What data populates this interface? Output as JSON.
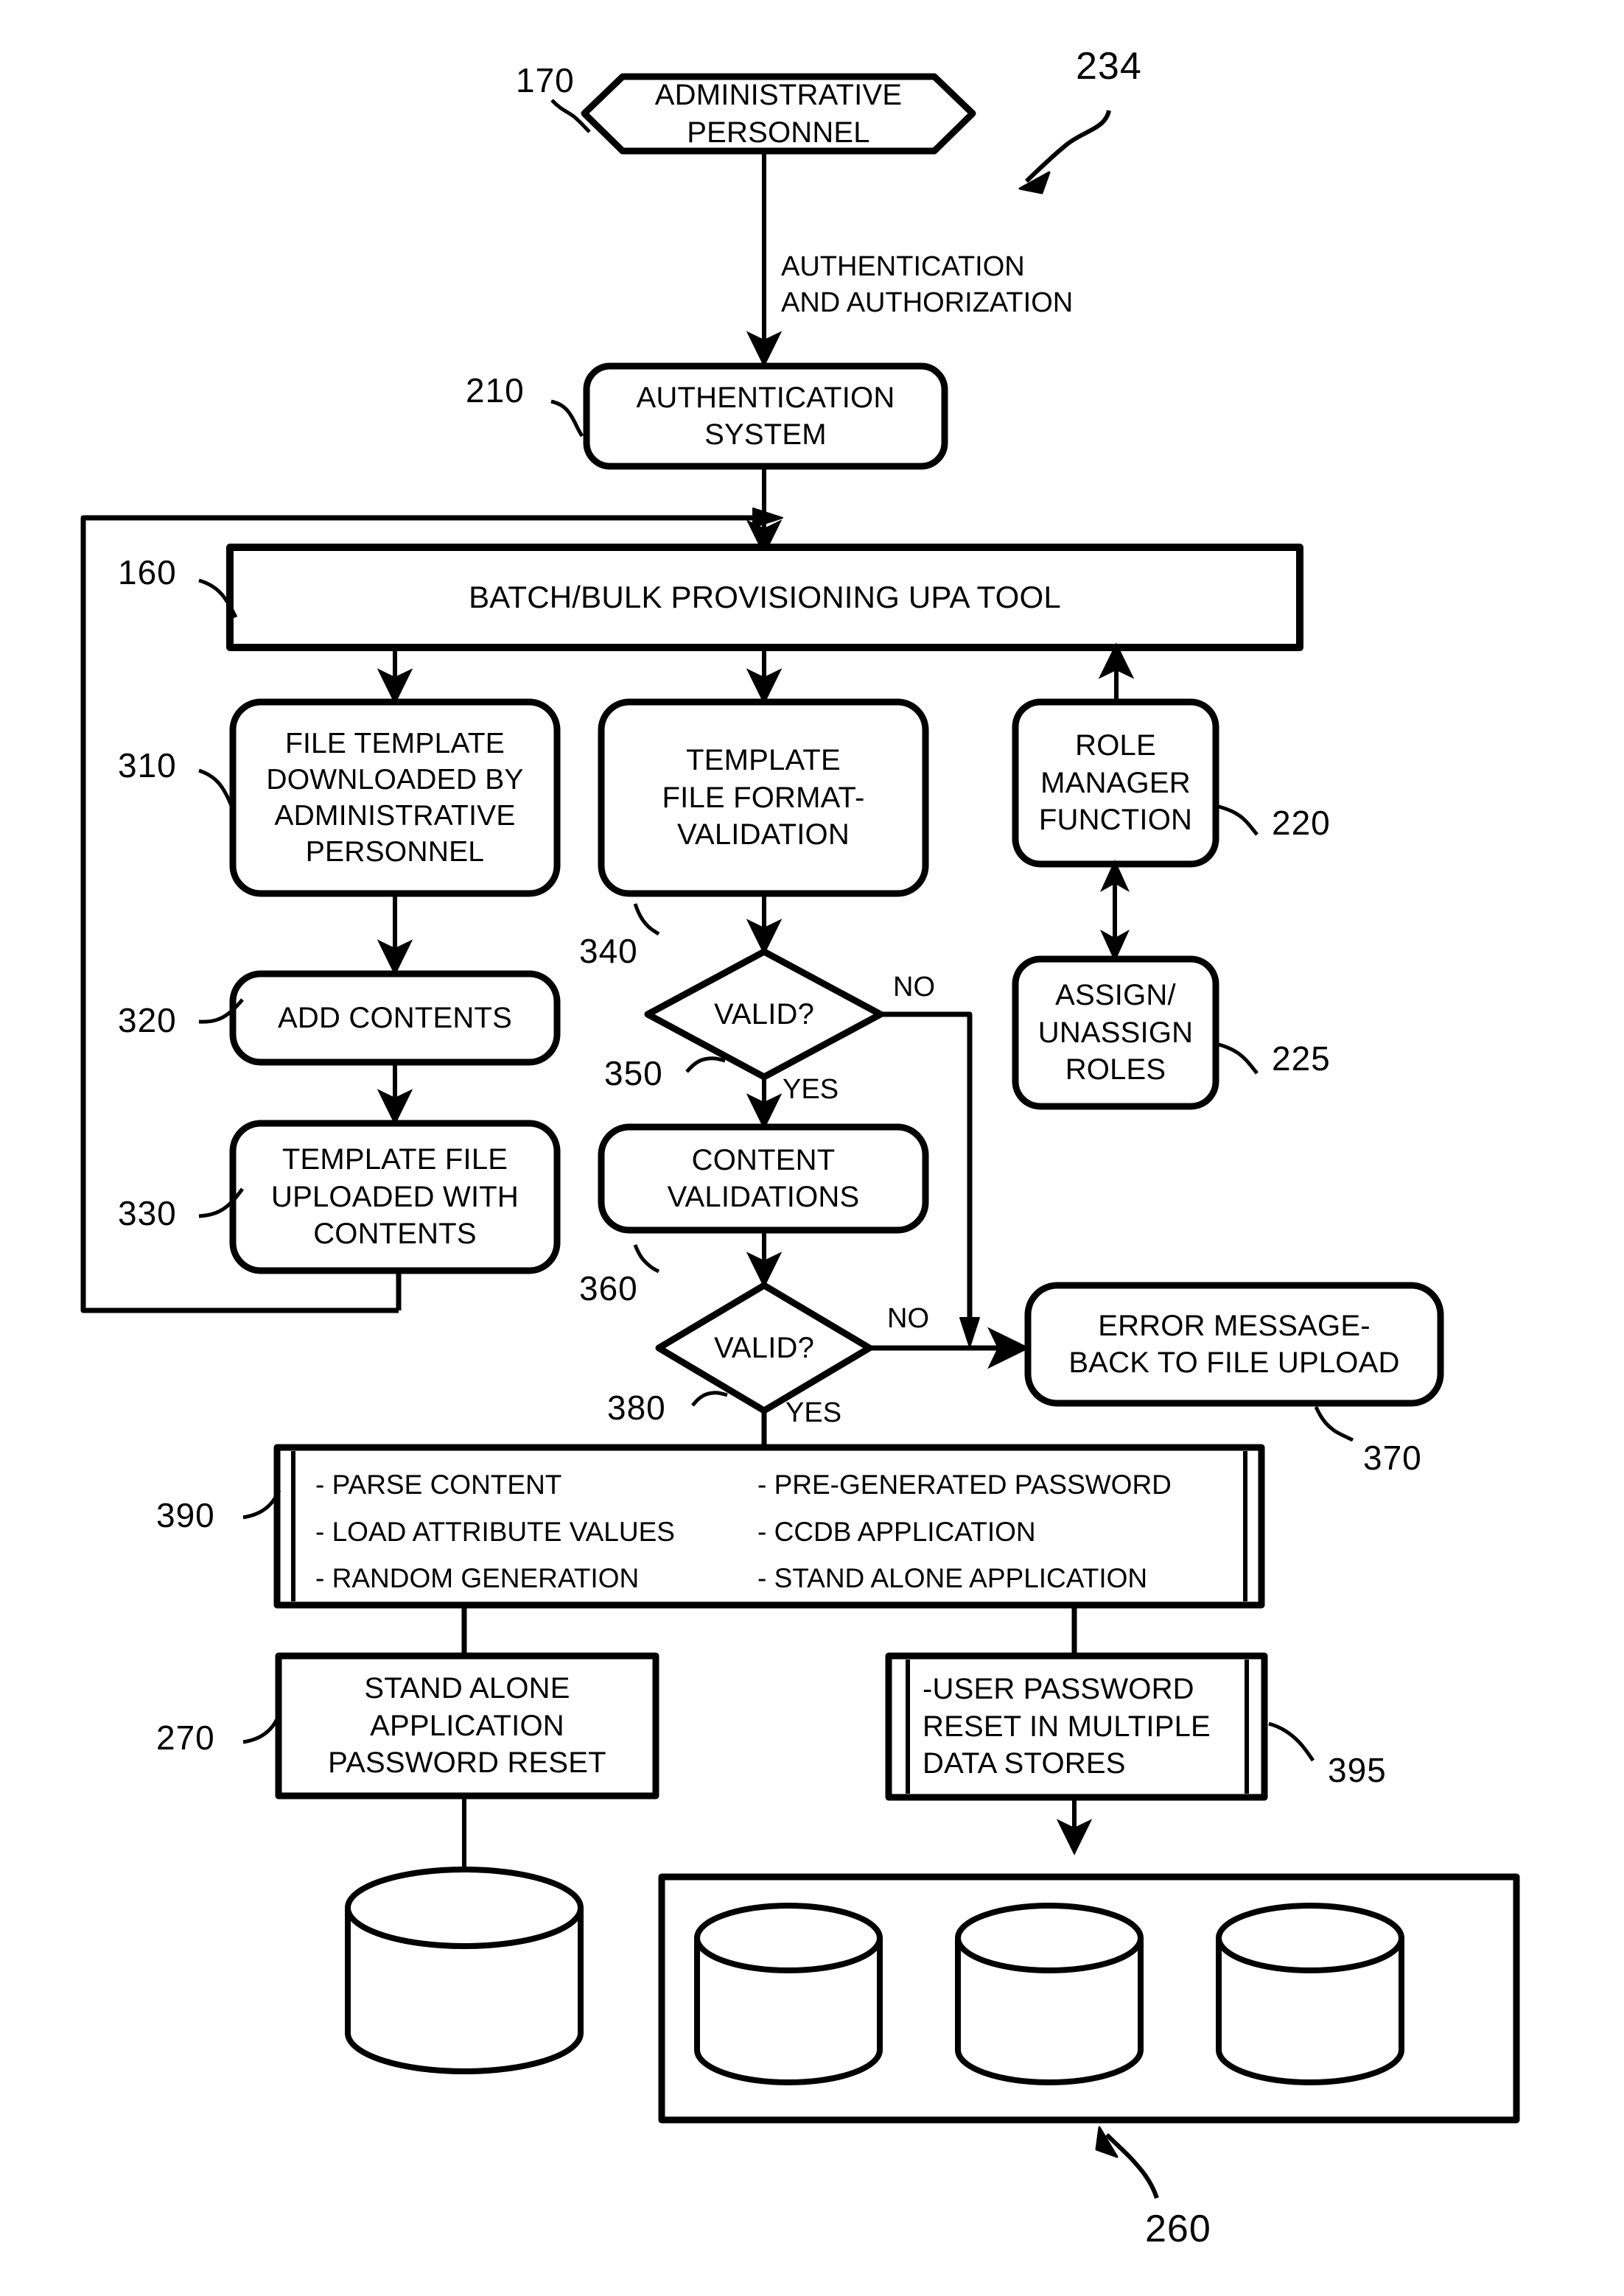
{
  "figure": {
    "ref_label": "234",
    "nodes": {
      "admin_personnel": {
        "ref": "170",
        "text": "ADMINISTRATIVE\nPERSONNEL"
      },
      "auth_system": {
        "ref": "210",
        "text": "AUTHENTICATION\nSYSTEM"
      },
      "upa_tool": {
        "ref": "160",
        "text": "BATCH/BULK PROVISIONING UPA TOOL"
      },
      "file_template": {
        "ref": "310",
        "text": "FILE TEMPLATE\nDOWNLOADED BY\nADMINISTRATIVE\nPERSONNEL"
      },
      "add_contents": {
        "ref": "320",
        "text": "ADD CONTENTS"
      },
      "template_uploaded": {
        "ref": "330",
        "text": "TEMPLATE FILE\nUPLOADED WITH\nCONTENTS"
      },
      "format_validation": {
        "ref": "340",
        "text": "TEMPLATE\nFILE FORMAT-\nVALIDATION"
      },
      "valid_decision_1": {
        "ref": "350",
        "text": "VALID?"
      },
      "content_validations": {
        "ref": "360",
        "text": "CONTENT\nVALIDATIONS"
      },
      "valid_decision_2": {
        "ref": "380",
        "text": "VALID?"
      },
      "role_manager": {
        "ref": "220",
        "text": "ROLE\nMANAGER\nFUNCTION"
      },
      "assign_roles": {
        "ref": "225",
        "text": "ASSIGN/\nUNASSIGN\nROLES"
      },
      "error_message": {
        "ref": "370",
        "text": "ERROR MESSAGE-\nBACK TO FILE UPLOAD"
      },
      "processing": {
        "ref": "390",
        "left_items": "- PARSE CONTENT\n- LOAD ATTRIBUTE VALUES\n- RANDOM GENERATION",
        "right_items": "- PRE-GENERATED PASSWORD\n- CCDB APPLICATION\n- STAND ALONE APPLICATION"
      },
      "standalone_reset": {
        "ref": "270",
        "text": "STAND ALONE\nAPPLICATION\nPASSWORD RESET"
      },
      "multi_reset": {
        "ref": "395",
        "text": "-USER PASSWORD\nRESET IN MULTIPLE\nDATA STORES"
      },
      "datastore_group": {
        "ref": "260"
      }
    },
    "edge_labels": {
      "auth_auth": "AUTHENTICATION\nAND AUTHORIZATION",
      "no_1": "NO",
      "yes_1": "YES",
      "no_2": "NO",
      "yes_2": "YES"
    },
    "colors": {
      "stroke": "#000000",
      "background": "#ffffff"
    }
  }
}
